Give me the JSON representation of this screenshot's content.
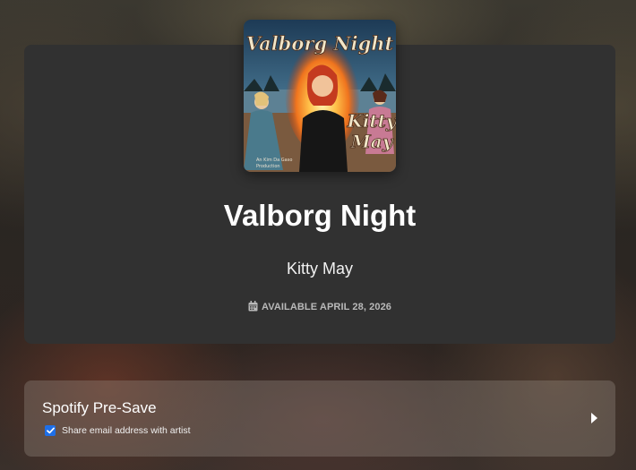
{
  "release": {
    "cover_title_art": "Valborg Night",
    "cover_artist_art": "Kitty May",
    "cover_credit_art": "An Kim Da Gaso Production",
    "title": "Valborg Night",
    "artist": "Kitty May",
    "availability": "AVAILABLE APRIL 28, 2026",
    "calendar_icon": "calendar-icon"
  },
  "presave": {
    "label": "Spotify Pre-Save",
    "share_email_label": "Share email address with artist",
    "share_email_checked": true,
    "arrow_icon": "caret-right-icon"
  },
  "colors": {
    "card_bg": "#313131",
    "checkbox_accent": "#1e6fe8"
  }
}
